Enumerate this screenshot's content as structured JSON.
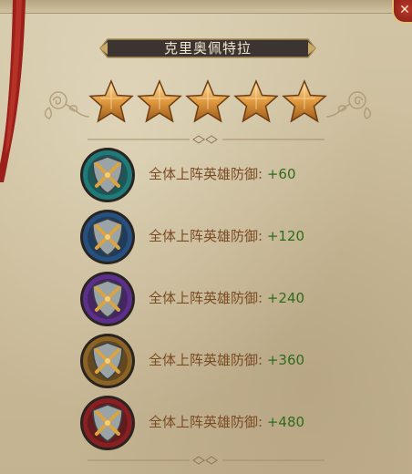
{
  "hero": {
    "name": "克里奥佩特拉",
    "stars": 5
  },
  "close_icon": "close-icon",
  "bonuses": [
    {
      "label": "全体上阵英雄防御:",
      "value": "+60",
      "color": "#1f7a7a"
    },
    {
      "label": "全体上阵英雄防御:",
      "value": "+120",
      "color": "#25507f"
    },
    {
      "label": "全体上阵英雄防御:",
      "value": "+240",
      "color": "#5b2f8a"
    },
    {
      "label": "全体上阵英雄防御:",
      "value": "+360",
      "color": "#8a6325"
    },
    {
      "label": "全体上阵英雄防御:",
      "value": "+480",
      "color": "#8a1f22"
    }
  ],
  "colors": {
    "label": "#7a4b22",
    "value": "#2f6b1c",
    "title_text": "#f1e6cf"
  }
}
